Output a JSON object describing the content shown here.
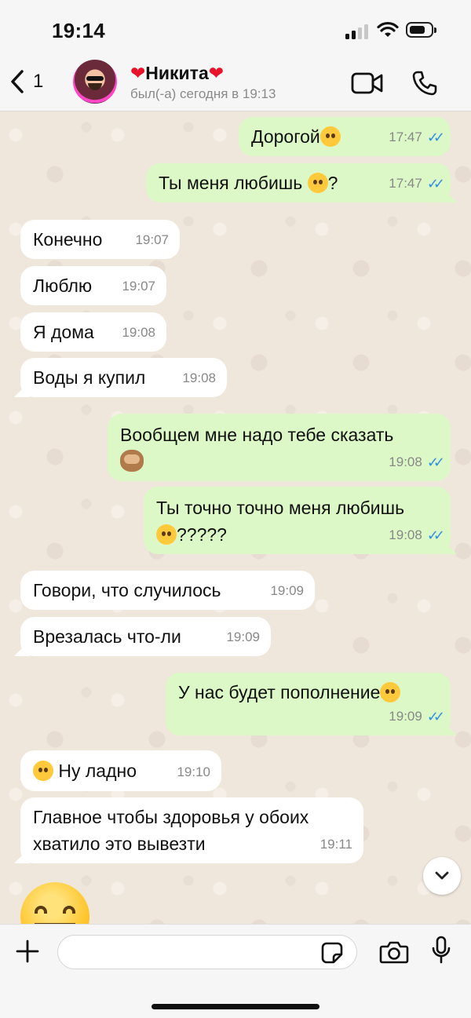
{
  "status_bar": {
    "time": "19:14"
  },
  "header": {
    "back_count": "1",
    "contact_name": "Никита",
    "contact_status": "был(-а) сегодня в 19:13"
  },
  "messages": [
    {
      "dir": "out",
      "text": "Дорогой",
      "emoji": "😘",
      "time": "17:47",
      "read": true
    },
    {
      "dir": "out",
      "text": "Ты меня любишь ",
      "emoji": "🥺",
      "suffix": "?",
      "time": "17:47",
      "read": true
    },
    {
      "dir": "in",
      "text": "Конечно",
      "time": "19:07"
    },
    {
      "dir": "in",
      "text": "Люблю",
      "time": "19:07"
    },
    {
      "dir": "in",
      "text": "Я дома",
      "time": "19:08"
    },
    {
      "dir": "in",
      "text": "Воды я купил",
      "time": "19:08"
    },
    {
      "dir": "out",
      "text": "Вообщем мне надо тебе сказать",
      "emoji": "🙈",
      "time": "19:08",
      "read": true
    },
    {
      "dir": "out",
      "text": "Ты точно точно меня любишь",
      "emoji": "🙄",
      "suffix": "?????",
      "time": "19:08",
      "read": true
    },
    {
      "dir": "in",
      "text": "Говори, что случилось",
      "time": "19:09"
    },
    {
      "dir": "in",
      "text": "Врезалась что-ли",
      "time": "19:09"
    },
    {
      "dir": "out",
      "text": "У нас будет пополнение",
      "emoji": "😬",
      "time": "19:09",
      "read": true
    },
    {
      "dir": "in",
      "text": "Ну ладно",
      "emoji": "🤔",
      "time": "19:10"
    },
    {
      "dir": "in",
      "text": "Главное чтобы здоровья у обоих хватило это вывезти",
      "time": "19:11"
    }
  ],
  "big_emoji": "😁",
  "input": {
    "placeholder": "",
    "value": ""
  },
  "colors": {
    "outgoing_bubble": "#dcf8c6",
    "incoming_bubble": "#ffffff",
    "read_ticks": "#2f8fe6",
    "chat_background": "#efe7dc"
  },
  "icons": [
    "back-chevron-icon",
    "video-call-icon",
    "phone-icon",
    "plus-icon",
    "sticker-icon",
    "camera-icon",
    "microphone-icon",
    "chevron-down-icon"
  ]
}
